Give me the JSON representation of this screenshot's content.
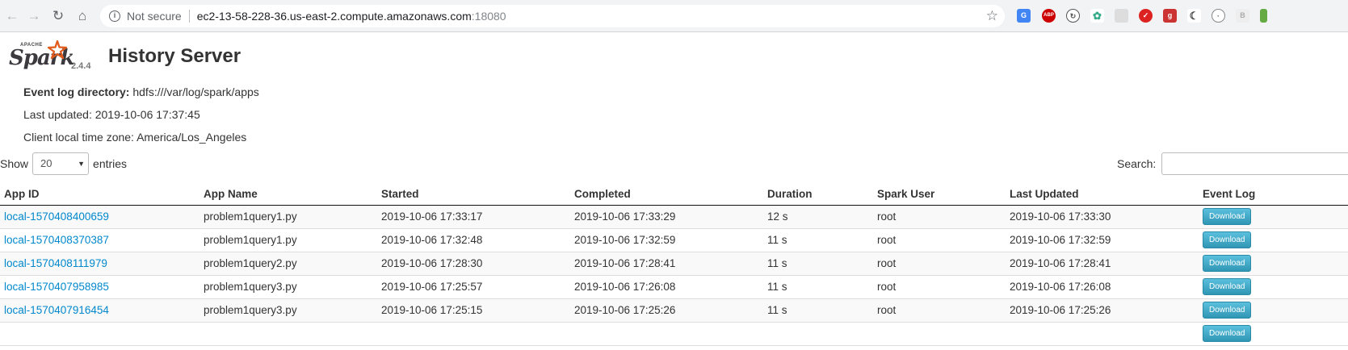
{
  "browser": {
    "security_label": "Not secure",
    "host": "ec2-13-58-228-36.us-east-2.compute.amazonaws.com",
    "port": ":18080"
  },
  "brand": {
    "apache": "APACHE",
    "wordmark": "Spark",
    "version": "2.4.4",
    "title": "History Server"
  },
  "info": {
    "event_log_label": "Event log directory:",
    "event_log_value": "hdfs:///var/log/spark/apps",
    "last_updated": "Last updated: 2019-10-06 17:37:45",
    "timezone": "Client local time zone: America/Los_Angeles"
  },
  "controls": {
    "show_label": "Show",
    "entries_value": "20",
    "entries_label": "entries",
    "search_label": "Search:"
  },
  "table": {
    "headers": [
      "App ID",
      "App Name",
      "Started",
      "Completed",
      "Duration",
      "Spark User",
      "Last Updated",
      "Event Log"
    ],
    "download_label": "Download",
    "rows": [
      [
        "local-1570408400659",
        "problem1query1.py",
        "2019-10-06 17:33:17",
        "2019-10-06 17:33:29",
        "12 s",
        "root",
        "2019-10-06 17:33:30"
      ],
      [
        "local-1570408370387",
        "problem1query1.py",
        "2019-10-06 17:32:48",
        "2019-10-06 17:32:59",
        "11 s",
        "root",
        "2019-10-06 17:32:59"
      ],
      [
        "local-1570408111979",
        "problem1query2.py",
        "2019-10-06 17:28:30",
        "2019-10-06 17:28:41",
        "11 s",
        "root",
        "2019-10-06 17:28:41"
      ],
      [
        "local-1570407958985",
        "problem1query3.py",
        "2019-10-06 17:25:57",
        "2019-10-06 17:26:08",
        "11 s",
        "root",
        "2019-10-06 17:26:08"
      ],
      [
        "local-1570407916454",
        "problem1query3.py",
        "2019-10-06 17:25:15",
        "2019-10-06 17:25:26",
        "11 s",
        "root",
        "2019-10-06 17:25:26"
      ]
    ]
  }
}
